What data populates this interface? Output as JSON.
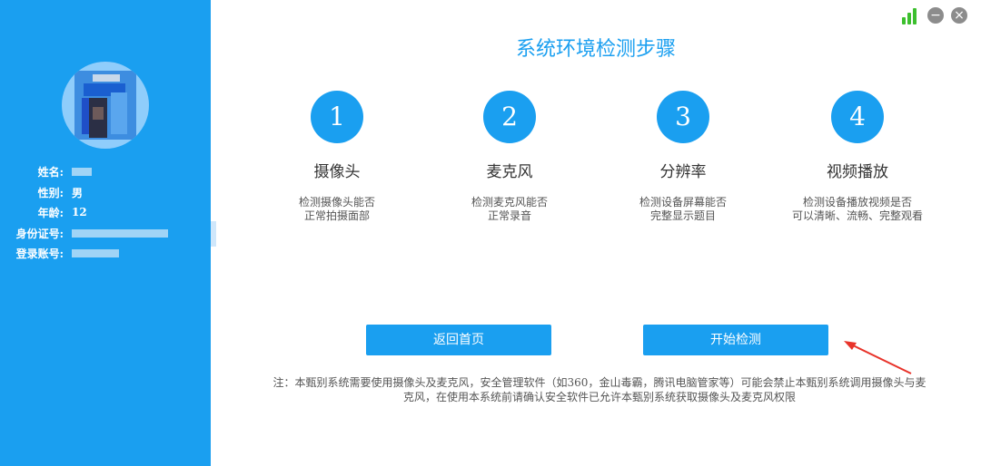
{
  "profile": {
    "name_label": "姓名:",
    "gender_label": "性别:",
    "gender_value": "男",
    "age_label": "年龄:",
    "age_value": "12",
    "id_label": "身份证号:",
    "account_label": "登录账号:"
  },
  "page": {
    "title": "系统环境检测步骤"
  },
  "steps": [
    {
      "num": "1",
      "name": "摄像头",
      "desc": "检测摄像头能否\n正常拍摄面部"
    },
    {
      "num": "2",
      "name": "麦克风",
      "desc": "检测麦克风能否\n正常录音"
    },
    {
      "num": "3",
      "name": "分辨率",
      "desc": "检测设备屏幕能否\n完整显示题目"
    },
    {
      "num": "4",
      "name": "视频播放",
      "desc": "检测设备播放视频是否\n可以清晰、流畅、完整观看"
    }
  ],
  "buttons": {
    "back": "返回首页",
    "start": "开始检测"
  },
  "note": "注：本甄别系统需要使用摄像头及麦克风，安全管理软件（如360，金山毒霸，腾讯电脑管家等）可能会禁止本甄别系统调用摄像头与麦克风，在使用本系统前请确认安全软件已允许本甄别系统获取摄像头及麦克风权限",
  "colors": {
    "accent": "#1a9ff0",
    "signal": "#3cbf2e",
    "arrow": "#e8332a"
  },
  "icons": {
    "signal": "signal-strength-icon",
    "minimize": "minimize-icon",
    "close": "close-icon"
  }
}
